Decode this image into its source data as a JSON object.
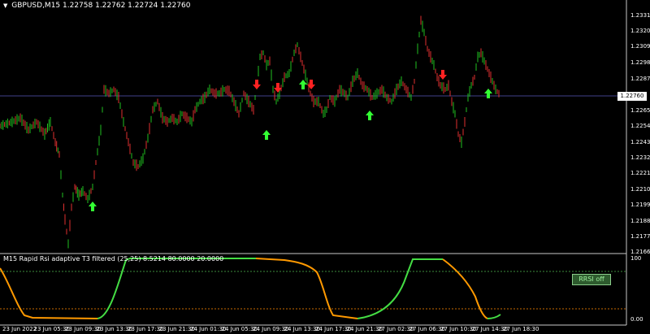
{
  "chart": {
    "title": "GBPUSD,M15  1.22758 1.22762 1.22724 1.22760",
    "indicator_title": "M15 Rapid Rsi adaptive T3 filtered (25,25) 8.5214 80.0000 20.0000",
    "current_price": "1.22760",
    "price_labels": [
      "1.23310",
      "1.23200",
      "1.23090",
      "1.22980",
      "1.22870",
      "1.22650",
      "1.22540",
      "1.22430",
      "1.22320",
      "1.22210",
      "1.22100",
      "1.21990",
      "1.21880",
      "1.21770",
      "1.21660"
    ],
    "indicator_labels": [
      "100",
      "0.00"
    ],
    "time_labels": [
      "23 Jun 2022",
      "23 Jun 05:30",
      "23 Jun 09:30",
      "23 Jun 13:30",
      "23 Jun 17:30",
      "23 Jun 21:30",
      "24 Jun 01:30",
      "24 Jun 05:30",
      "24 Jun 09:30",
      "24 Jun 13:30",
      "24 Jun 17:30",
      "24 Jun 21:30",
      "27 Jun 02:30",
      "27 Jun 06:30",
      "27 Jun 10:30",
      "27 Jun 14:30",
      "27 Jun 18:30"
    ],
    "rrsi_button": "RRSI off",
    "colors": {
      "bull": "#1fbf1f",
      "bear": "#e03030",
      "arrow_up": "#33ff33",
      "arrow_down": "#ff2222",
      "line_up": "#44dd44",
      "line_down": "#ff9900",
      "level_high": "#3c8c3c",
      "level_low": "#c86a00"
    }
  }
}
